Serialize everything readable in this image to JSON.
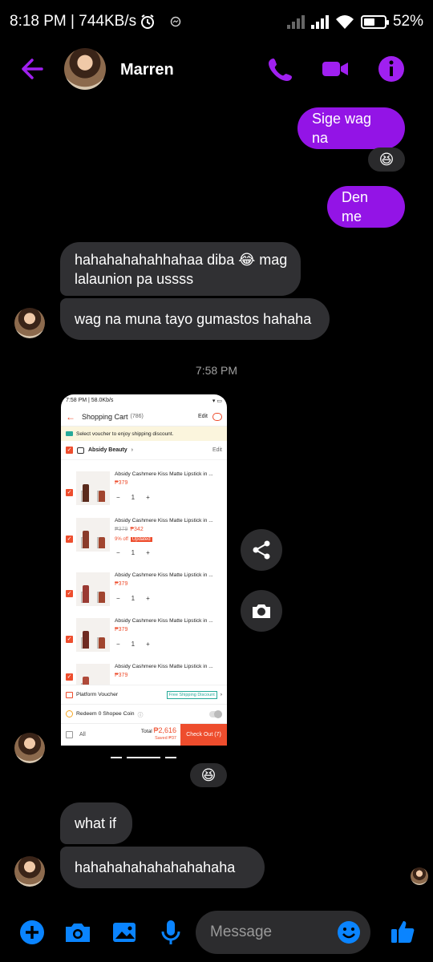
{
  "status_bar": {
    "time_speed": "8:18 PM | 744KB/s",
    "alarm_icon": "alarm-clock-icon",
    "battery": "52%"
  },
  "header": {
    "contact_name": "Marren",
    "icons": [
      "back-arrow-icon",
      "phone-icon",
      "video-camera-icon",
      "info-icon"
    ],
    "accent_color": "#a020f0"
  },
  "messages": {
    "out_1": "Sige wag na",
    "out_1_reaction": "😆",
    "out_2": "Den me",
    "in_1": "hahahahahahhahaa diba 😂 mag lalaunion pa ussss",
    "in_2": "wag na muna tayo gumastos hahaha",
    "timestamp": "7:58 PM",
    "image_reaction": "😆",
    "in_3": "what if",
    "in_4": "hahahahahahahahahaha"
  },
  "shared_screenshot": {
    "status": "7:58 PM | 58.0Kb/s",
    "title": "Shopping Cart",
    "count": "(786)",
    "edit": "Edit",
    "voucher_notice": "Select voucher to enjoy shipping discount.",
    "shop_name": "Absidy Beauty",
    "shop_edit": "Edit",
    "items": [
      {
        "title": "Absidy Cashmere Kiss Matte Lipstick in ...",
        "price": "₱379",
        "qty": "1"
      },
      {
        "title": "Absidy Cashmere Kiss Matte Lipstick in ...",
        "old_price": "₱379",
        "price": "₱342",
        "discount": "9% off",
        "tag": "Updated",
        "qty": "1"
      },
      {
        "title": "Absidy Cashmere Kiss Matte Lipstick in ...",
        "price": "₱379",
        "qty": "1"
      },
      {
        "title": "Absidy Cashmere Kiss Matte Lipstick in ...",
        "price": "₱379",
        "qty": "1"
      },
      {
        "title": "Absidy Cashmere Kiss Matte Lipstick in ...",
        "price": "₱379"
      }
    ],
    "platform_voucher": "Platform Voucher",
    "free_shipping": "Free Shipping Discount",
    "redeem": "Redeem 0 Shopee Coin",
    "all": "All",
    "total_label": "Total",
    "total": "₱2,616",
    "saved": "Saved ₱37",
    "checkout": "Check Out (7)"
  },
  "actions": {
    "share_icon": "share-icon",
    "camera_icon": "camera-icon"
  },
  "composer": {
    "placeholder": "Message",
    "icons": [
      "plus-icon",
      "camera-icon",
      "image-icon",
      "microphone-icon",
      "emoji-icon",
      "thumbs-up-icon"
    ]
  }
}
